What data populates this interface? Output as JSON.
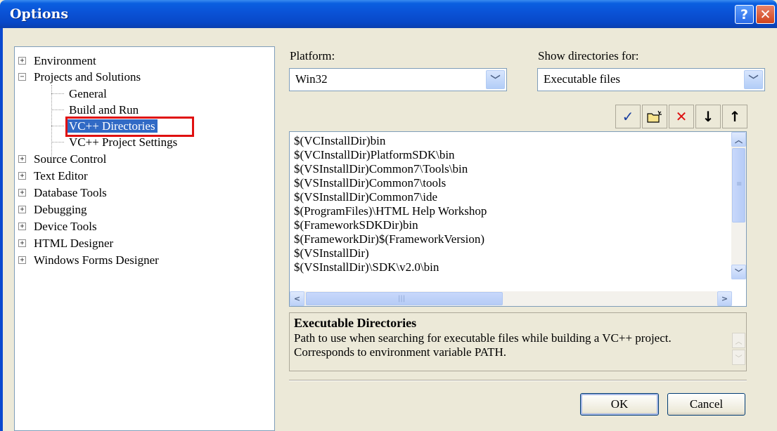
{
  "window": {
    "title": "Options",
    "help_glyph": "?",
    "close_glyph": "✕"
  },
  "tree": {
    "items": [
      {
        "label": "Environment",
        "expander": "+"
      },
      {
        "label": "Projects and Solutions",
        "expander": "−"
      },
      {
        "label": "General"
      },
      {
        "label": "Build and Run"
      },
      {
        "label": "VC++ Directories",
        "selected": true
      },
      {
        "label": "VC++ Project Settings"
      },
      {
        "label": "Source Control",
        "expander": "+"
      },
      {
        "label": "Text Editor",
        "expander": "+"
      },
      {
        "label": "Database Tools",
        "expander": "+"
      },
      {
        "label": "Debugging",
        "expander": "+"
      },
      {
        "label": "Device Tools",
        "expander": "+"
      },
      {
        "label": "HTML Designer",
        "expander": "+"
      },
      {
        "label": "Windows Forms Designer",
        "expander": "+"
      }
    ]
  },
  "platform": {
    "label": "Platform:",
    "value": "Win32"
  },
  "show_dirs": {
    "label": "Show directories for:",
    "value": "Executable files"
  },
  "toolbar": {
    "check_glyph": "✓",
    "delete_glyph": "✕",
    "down_glyph": "↓",
    "up_glyph": "↑"
  },
  "directories": [
    "$(VCInstallDir)bin",
    "$(VCInstallDir)PlatformSDK\\bin",
    "$(VSInstallDir)Common7\\Tools\\bin",
    "$(VSInstallDir)Common7\\tools",
    "$(VSInstallDir)Common7\\ide",
    "$(ProgramFiles)\\HTML Help Workshop",
    "$(FrameworkSDKDir)bin",
    "$(FrameworkDir)$(FrameworkVersion)",
    "$(VSInstallDir)",
    "$(VSInstallDir)\\SDK\\v2.0\\bin"
  ],
  "description": {
    "title": "Executable Directories",
    "text": "Path to use when searching for executable files while building a VC++ project.  Corresponds to environment variable PATH."
  },
  "buttons": {
    "ok": "OK",
    "cancel": "Cancel"
  },
  "colors": {
    "titlebar": "#0a52d6",
    "selection": "#316ac5",
    "highlight_box": "#e01010",
    "dialog_bg": "#ece9d8"
  }
}
